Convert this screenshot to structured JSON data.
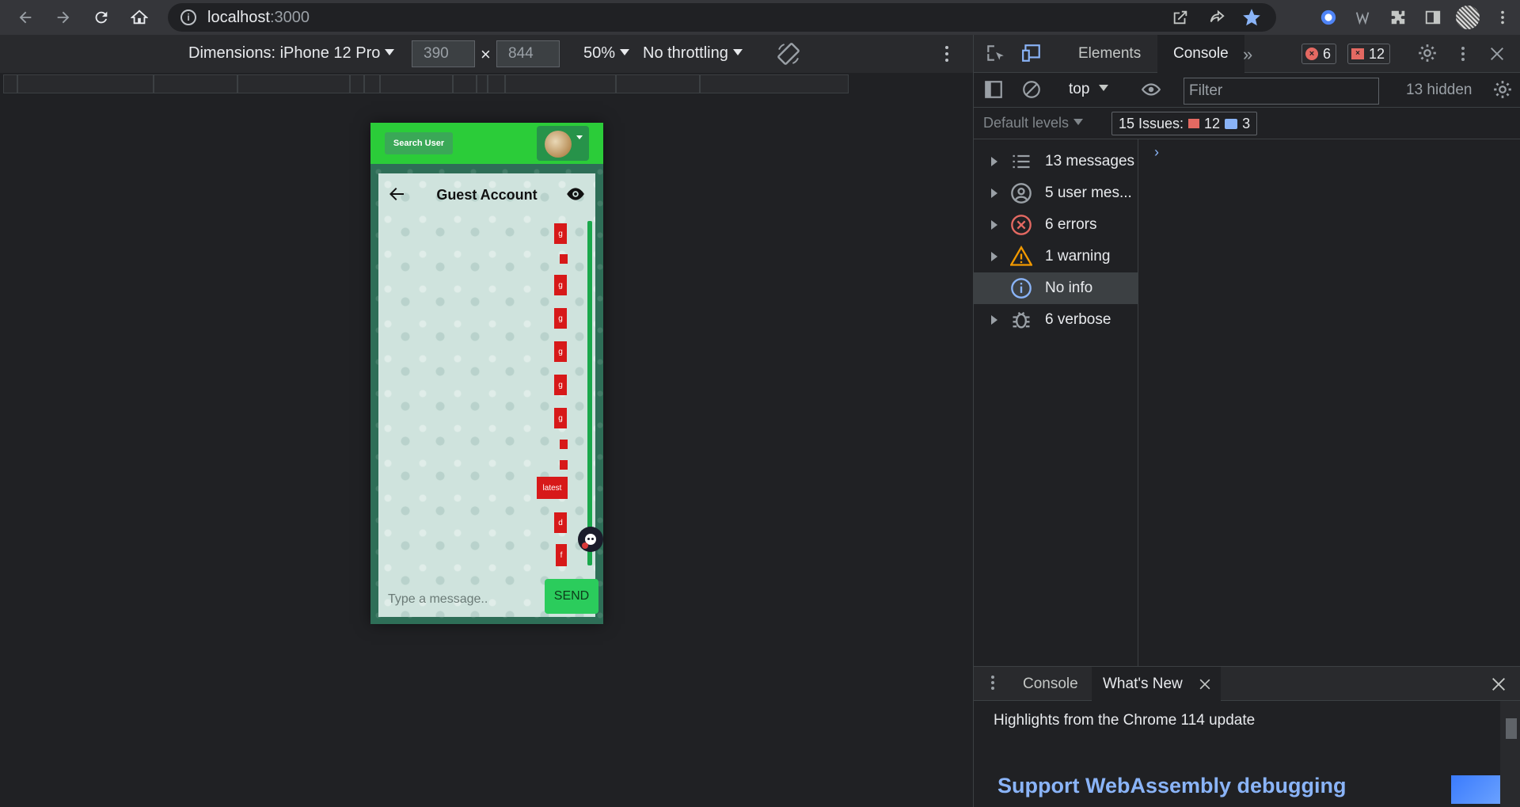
{
  "browser": {
    "url_host": "localhost",
    "url_port": ":3000"
  },
  "device_toolbar": {
    "dimensions_label": "Dimensions: iPhone 12 Pro",
    "width": "390",
    "height": "844",
    "times": "×",
    "zoom": "50%",
    "throttling": "No throttling"
  },
  "app": {
    "search_user_label": "Search User",
    "chat_title": "Guest Account",
    "messages": [
      {
        "text": "g"
      },
      {
        "text": ""
      },
      {
        "text": "g"
      },
      {
        "text": "g"
      },
      {
        "text": "g"
      },
      {
        "text": "g"
      },
      {
        "text": "g"
      },
      {
        "text": ""
      },
      {
        "text": ""
      },
      {
        "text": "latest"
      },
      {
        "text": "d"
      },
      {
        "text": "f"
      }
    ],
    "message_placeholder": "Type a message..",
    "send_label": "SEND",
    "colors": {
      "header_green": "#2bcc39",
      "message_red": "#d71919",
      "send_green": "#2bcc5c"
    }
  },
  "devtools": {
    "tabs": [
      "Elements",
      "Console"
    ],
    "active_tab": "Console",
    "error_count": "6",
    "issue_count": "12",
    "context": "top",
    "filter_placeholder": "Filter",
    "hidden": "13 hidden",
    "default_levels": "Default levels",
    "issues_label": "15 Issues:",
    "issues_errors": "12",
    "issues_info": "3",
    "sidebar": [
      {
        "label": "13 messages",
        "icon": "list-icon"
      },
      {
        "label": "5 user mes...",
        "icon": "user-icon"
      },
      {
        "label": "6 errors",
        "icon": "error-icon"
      },
      {
        "label": "1 warning",
        "icon": "warning-icon"
      },
      {
        "label": "No info",
        "icon": "info-icon"
      },
      {
        "label": "6 verbose",
        "icon": "bug-icon"
      }
    ],
    "drawer_tabs": [
      "Console",
      "What's New"
    ],
    "whats_new_heading": "Highlights from the Chrome 114 update",
    "whats_new_title": "Support WebAssembly debugging"
  }
}
